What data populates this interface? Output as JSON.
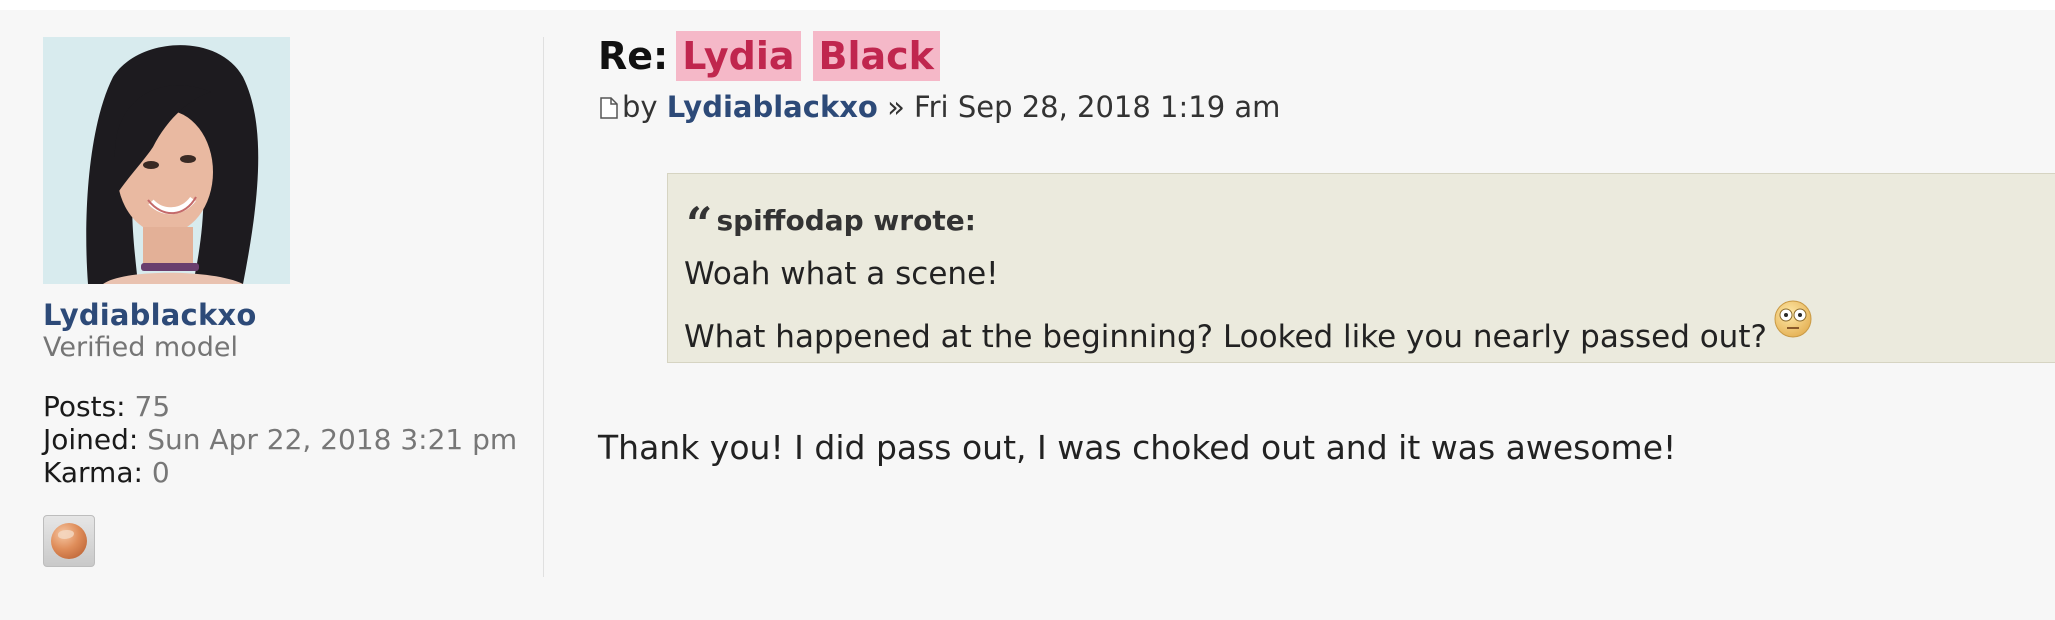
{
  "profile": {
    "username": "Lydiablackxo",
    "rank": "Verified model",
    "posts_label": "Posts:",
    "posts_value": "75",
    "joined_label": "Joined:",
    "joined_value": "Sun Apr 22, 2018 3:21 pm",
    "karma_label": "Karma:",
    "karma_value": "0"
  },
  "post": {
    "title_prefix": "Re:",
    "title_words": [
      "Lydia",
      "Black"
    ],
    "by_label": "by",
    "author": "Lydiablackxo",
    "separator": "»",
    "date": "Fri Sep 28, 2018 1:19 am",
    "quote": {
      "author_line": "spiffodap wrote:",
      "lines": [
        "Woah what a scene!",
        "What happened at the beginning? Looked like you nearly passed out?"
      ]
    },
    "body": "Thank you! I did pass out, I was choked out and it was awesome!"
  },
  "colors": {
    "accent_link": "#2d4a78",
    "highlight_bg": "#f5b8c8",
    "highlight_text": "#c0264e",
    "quote_bg": "#ebeadd"
  },
  "icons": {
    "post_icon": "page-icon",
    "quote_icon": "quote-mark-icon",
    "smiley": "eek-smiley-icon",
    "contact": "globe-icon"
  }
}
